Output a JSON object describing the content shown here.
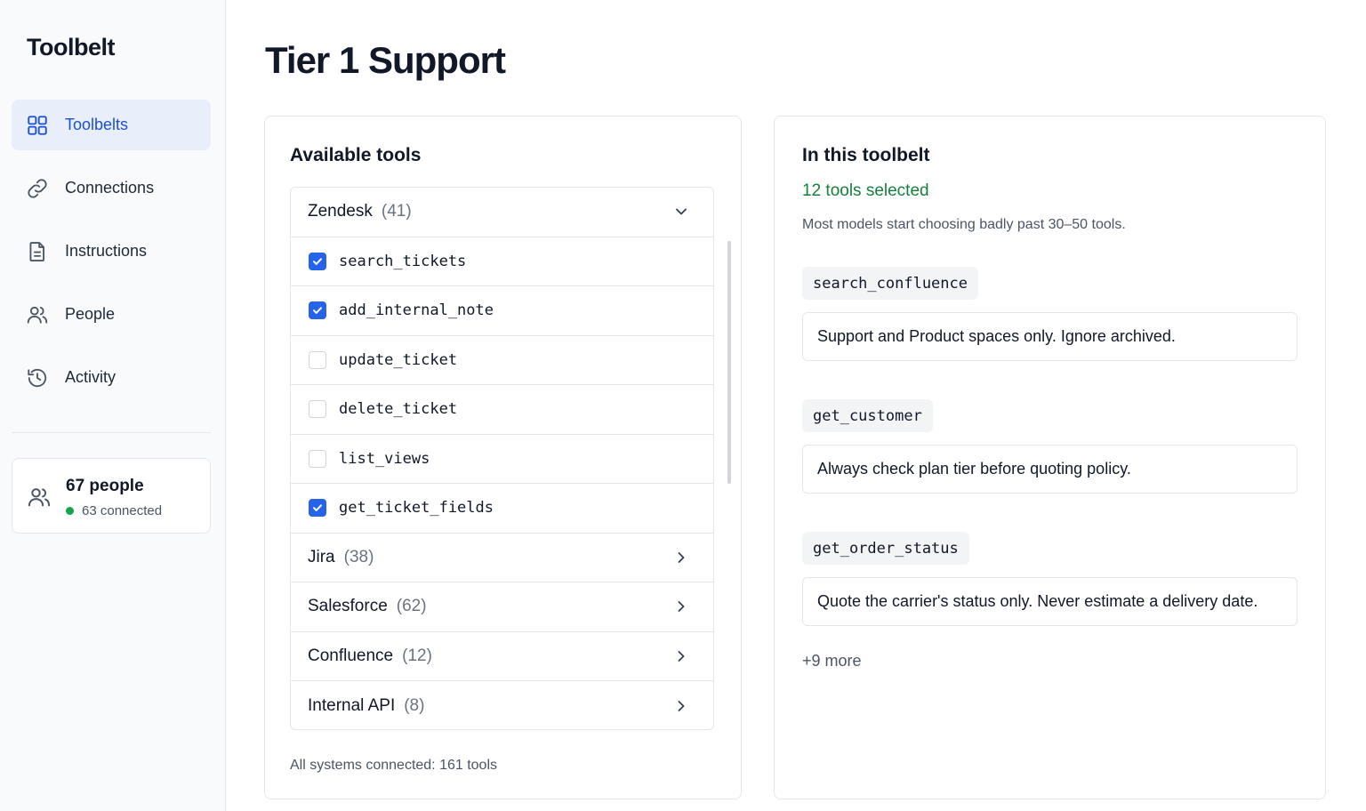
{
  "app": {
    "brand": "Toolbelt"
  },
  "sidebar": {
    "items": [
      {
        "label": "Toolbelts",
        "icon": "grid-icon",
        "active": true
      },
      {
        "label": "Connections",
        "icon": "link-icon"
      },
      {
        "label": "Instructions",
        "icon": "document-icon"
      },
      {
        "label": "People",
        "icon": "users-icon"
      },
      {
        "label": "Activity",
        "icon": "history-icon"
      }
    ],
    "people_card": {
      "count": "67 people",
      "status": "63 connected",
      "status_color": "#16a34a"
    }
  },
  "page": {
    "title": "Tier 1 Support"
  },
  "available": {
    "heading": "Available tools",
    "expanded_group": {
      "name": "Zendesk",
      "count": "(41)"
    },
    "tools": [
      {
        "name": "search_tickets",
        "checked": true
      },
      {
        "name": "add_internal_note",
        "checked": true
      },
      {
        "name": "update_ticket",
        "checked": false
      },
      {
        "name": "delete_ticket",
        "checked": false
      },
      {
        "name": "list_views",
        "checked": false
      },
      {
        "name": "get_ticket_fields",
        "checked": true
      }
    ],
    "groups": [
      {
        "name": "Jira",
        "count": "(38)"
      },
      {
        "name": "Salesforce",
        "count": "(62)"
      },
      {
        "name": "Confluence",
        "count": "(12)"
      },
      {
        "name": "Internal API",
        "count": "(8)"
      }
    ],
    "footnote": "All systems connected: 161 tools"
  },
  "toolbelt": {
    "heading": "In this toolbelt",
    "selected_count": "12 tools selected",
    "hint": "Most models start choosing badly past 30–50 tools.",
    "entries": [
      {
        "tool": "search_confluence",
        "note": "Support and Product spaces only. Ignore archived."
      },
      {
        "tool": "get_customer",
        "note": "Always check plan tier before quoting policy."
      },
      {
        "tool": "get_order_status",
        "note": "Quote the carrier's status only. Never estimate a delivery date."
      }
    ],
    "more": "+9 more"
  },
  "colors": {
    "accent": "#2563eb",
    "active_nav_bg": "#e8effb",
    "success": "#15803d"
  }
}
